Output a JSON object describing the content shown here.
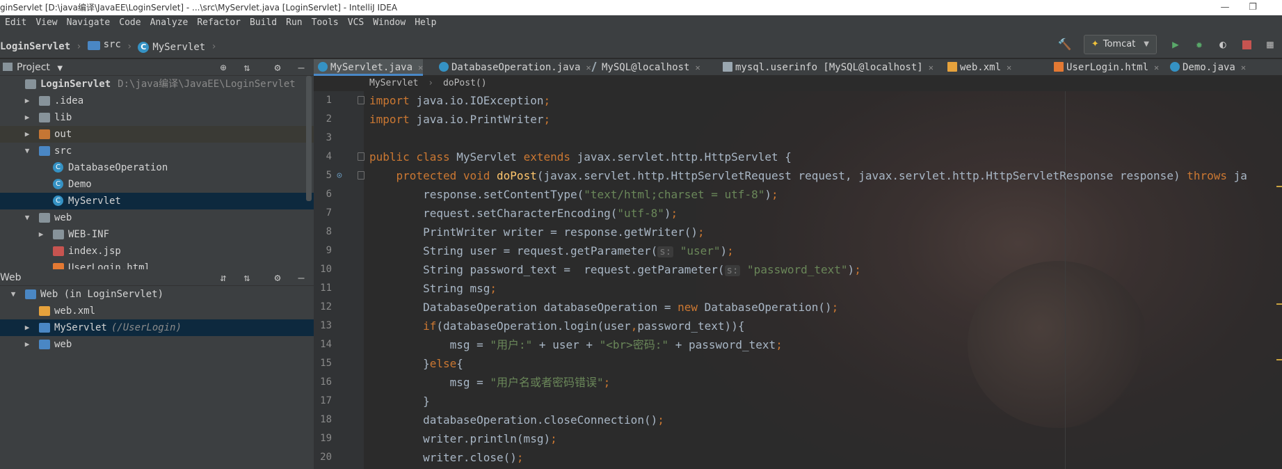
{
  "window": {
    "title": "ginServlet [D:\\java编译\\JavaEE\\LoginServlet] - ...\\src\\MyServlet.java [LoginServlet] - IntelliJ IDEA",
    "minimize_glyph": "—",
    "maximize_glyph": "❐"
  },
  "menu": [
    "Edit",
    "View",
    "Navigate",
    "Code",
    "Analyze",
    "Refactor",
    "Build",
    "Run",
    "Tools",
    "VCS",
    "Window",
    "Help"
  ],
  "navbar": {
    "project": "LoginServlet",
    "folder": "src",
    "file": "MyServlet",
    "run_config": "Tomcat"
  },
  "project_panel": {
    "title": "Project",
    "tree": [
      {
        "label": "LoginServlet",
        "path": "D:\\java编译\\JavaEE\\LoginServlet",
        "icon": "module-folder-icon",
        "arrow": "",
        "level": 0
      },
      {
        "label": ".idea",
        "icon": "folder-icon",
        "arrow": "▶",
        "level": 1
      },
      {
        "label": "lib",
        "icon": "folder-icon",
        "arrow": "▶",
        "level": 1
      },
      {
        "label": "out",
        "icon": "excluded-folder-icon",
        "arrow": "▶",
        "level": 1
      },
      {
        "label": "src",
        "icon": "source-folder-icon",
        "arrow": "▼",
        "level": 1
      },
      {
        "label": "DatabaseOperation",
        "icon": "class-icon",
        "arrow": "",
        "level": 2
      },
      {
        "label": "Demo",
        "icon": "class-icon",
        "arrow": "",
        "level": 2
      },
      {
        "label": "MyServlet",
        "icon": "class-icon",
        "arrow": "",
        "level": 2
      },
      {
        "label": "web",
        "icon": "folder-icon",
        "arrow": "▼",
        "level": 1
      },
      {
        "label": "WEB-INF",
        "icon": "folder-icon",
        "arrow": "▶",
        "level": 2
      },
      {
        "label": "index.jsp",
        "icon": "jsp-icon",
        "arrow": "",
        "level": 2
      },
      {
        "label": "UserLogin.html",
        "icon": "html-icon",
        "arrow": "",
        "level": 2
      }
    ]
  },
  "web_panel": {
    "title": "Web",
    "tree": [
      {
        "label": "Web (in LoginServlet)",
        "icon": "web-module-icon",
        "arrow": "▼",
        "level": 0
      },
      {
        "label": "web.xml",
        "icon": "xml-icon",
        "arrow": "",
        "level": 1
      },
      {
        "label": "MyServlet",
        "sub": "(/UserLogin)",
        "icon": "servlet-icon",
        "arrow": "▶",
        "level": 1
      },
      {
        "label": "web",
        "icon": "web-folder-icon",
        "arrow": "▶",
        "level": 1
      }
    ]
  },
  "tabs": [
    {
      "label": "MyServlet.java",
      "icon": "class-icon",
      "active": true
    },
    {
      "label": "DatabaseOperation.java",
      "icon": "class-icon",
      "active": false
    },
    {
      "label": "MySQL@localhost",
      "icon": "datasource-icon",
      "active": false
    },
    {
      "label": "mysql.userinfo [MySQL@localhost]",
      "icon": "table-icon",
      "active": false
    },
    {
      "label": "web.xml",
      "icon": "xml-icon",
      "active": false
    },
    {
      "label": "UserLogin.html",
      "icon": "html-icon",
      "active": false
    },
    {
      "label": "Demo.java",
      "icon": "class-icon",
      "active": false
    }
  ],
  "editor_breadcrumb": [
    "MyServlet",
    "doPost()"
  ],
  "code_lines": [
    [
      [
        "kw",
        "import "
      ],
      [
        "t",
        "java.io.IOException"
      ],
      [
        "kw",
        ";"
      ]
    ],
    [
      [
        "kw",
        "import "
      ],
      [
        "t",
        "java.io.PrintWriter"
      ],
      [
        "kw",
        ";"
      ]
    ],
    [],
    [
      [
        "kw",
        "public class "
      ],
      [
        "t",
        "MyServlet "
      ],
      [
        "kw",
        "extends "
      ],
      [
        "t",
        "javax.servlet.http.HttpServlet {"
      ]
    ],
    [
      [
        "t",
        "    "
      ],
      [
        "kw",
        "protected void "
      ],
      [
        "fn",
        "doPost"
      ],
      [
        "t",
        "(javax.servlet.http.HttpServletRequest request, javax.servlet.http.HttpServletResponse response) "
      ],
      [
        "kw",
        "throws "
      ],
      [
        "t",
        "ja"
      ]
    ],
    [
      [
        "t",
        "        response.setContentType("
      ],
      [
        "str",
        "\"text/html;charset = utf-8\""
      ],
      [
        "t",
        ")"
      ],
      [
        "kw",
        ";"
      ]
    ],
    [
      [
        "t",
        "        request.setCharacterEncoding("
      ],
      [
        "str",
        "\"utf-8\""
      ],
      [
        "t",
        ")"
      ],
      [
        "kw",
        ";"
      ]
    ],
    [
      [
        "t",
        "        PrintWriter writer = response.getWriter()"
      ],
      [
        "kw",
        ";"
      ]
    ],
    [
      [
        "t",
        "        String user = request.getParameter("
      ],
      [
        "hint",
        "s:"
      ],
      [
        "t",
        " "
      ],
      [
        "str",
        "\"user\""
      ],
      [
        "t",
        ")"
      ],
      [
        "kw",
        ";"
      ]
    ],
    [
      [
        "t",
        "        String password_text =  request.getParameter("
      ],
      [
        "hint",
        "s:"
      ],
      [
        "t",
        " "
      ],
      [
        "str",
        "\"password_text\""
      ],
      [
        "t",
        ")"
      ],
      [
        "kw",
        ";"
      ]
    ],
    [
      [
        "t",
        "        String msg"
      ],
      [
        "kw",
        ";"
      ]
    ],
    [
      [
        "t",
        "        DatabaseOperation databaseOperation = "
      ],
      [
        "kw",
        "new "
      ],
      [
        "t",
        "DatabaseOperation()"
      ],
      [
        "kw",
        ";"
      ]
    ],
    [
      [
        "t",
        "        "
      ],
      [
        "kw",
        "if"
      ],
      [
        "t",
        "(databaseOperation.login(user"
      ],
      [
        "kw",
        ","
      ],
      [
        "t",
        "password_text)){"
      ]
    ],
    [
      [
        "t",
        "            msg = "
      ],
      [
        "str",
        "\"用户:\""
      ],
      [
        "t",
        " + user + "
      ],
      [
        "str",
        "\"<br>密码:\""
      ],
      [
        "t",
        " + password_text"
      ],
      [
        "kw",
        ";"
      ]
    ],
    [
      [
        "t",
        "        }"
      ],
      [
        "kw",
        "else"
      ],
      [
        "t",
        "{"
      ]
    ],
    [
      [
        "t",
        "            msg = "
      ],
      [
        "str",
        "\"用户名或者密码错误\""
      ],
      [
        "kw",
        ";"
      ]
    ],
    [
      [
        "t",
        "        }"
      ]
    ],
    [
      [
        "t",
        "        databaseOperation.closeConnection()"
      ],
      [
        "kw",
        ";"
      ]
    ],
    [
      [
        "t",
        "        writer.println(msg)"
      ],
      [
        "kw",
        ";"
      ]
    ],
    [
      [
        "t",
        "        writer.close()"
      ],
      [
        "kw",
        ";"
      ]
    ]
  ],
  "colors": {
    "keyword": "#cc7832",
    "function": "#ffc66d",
    "string": "#6a8759",
    "text": "#a9b7c6",
    "selection": "#0d293e",
    "accent": "#4a88c7"
  }
}
